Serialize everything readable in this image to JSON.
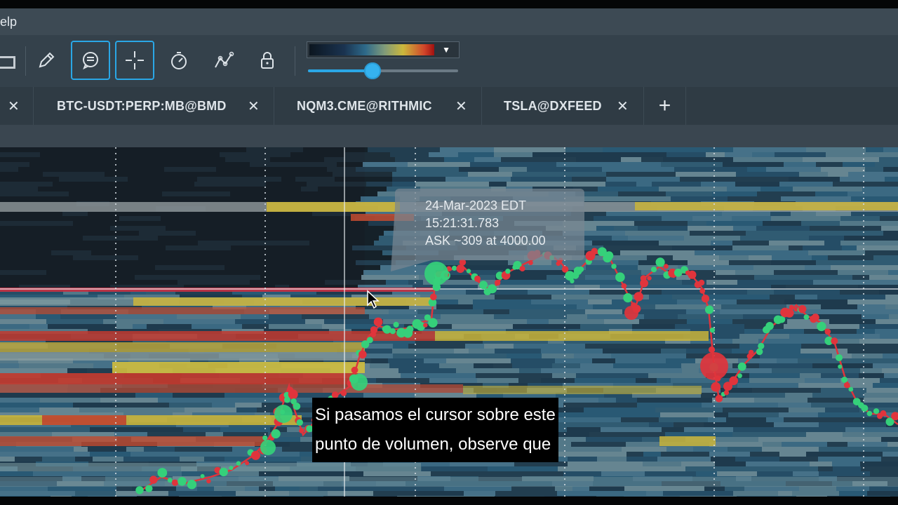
{
  "menu": {
    "help_label": "elp"
  },
  "toolbar": {
    "tools": [
      {
        "name": "pencil-icon",
        "active": false
      },
      {
        "name": "comment-icon",
        "active": true
      },
      {
        "name": "crosshair-icon",
        "active": true
      },
      {
        "name": "stopwatch-icon",
        "active": false
      },
      {
        "name": "line-chart-icon",
        "active": false
      },
      {
        "name": "lock-icon",
        "active": false
      }
    ],
    "colormap_dropdown_icon": "caret-down-icon",
    "slider_level_fraction": 0.43,
    "accent_color": "#2aa7e6"
  },
  "tabs": {
    "items": [
      {
        "label": "BTC-USDT:PERP:MB@BMD"
      },
      {
        "label": "NQM3.CME@RITHMIC"
      },
      {
        "label": "TSLA@DXFEED"
      }
    ],
    "close_glyph": "✕",
    "add_glyph": "+"
  },
  "tooltip": {
    "date": "24-Mar-2023 EDT",
    "time": "15:21:31.783",
    "detail": "ASK ~309 at 4000.00"
  },
  "subtitle": {
    "line1": "Si pasamos el cursor sobre este",
    "line2": "punto de volumen, observe que"
  },
  "colors": {
    "buy_trade": "#35d07a",
    "sell_trade": "#e0343c",
    "heatmap_high": "#d8c23a",
    "heatmap_max": "#c9332a"
  }
}
